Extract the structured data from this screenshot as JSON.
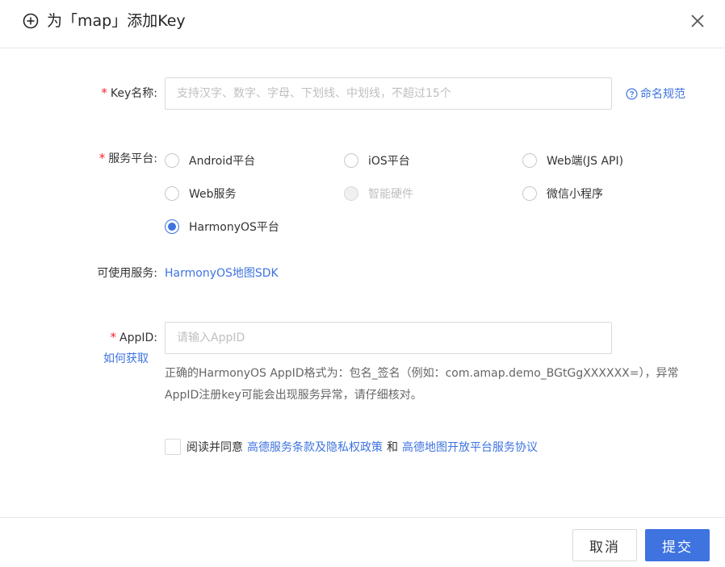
{
  "dialog": {
    "title": "为「map」添加Key"
  },
  "form": {
    "key_name": {
      "label": "Key名称:",
      "placeholder": "支持汉字、数字、字母、下划线、中划线，不超过15个",
      "value": "",
      "help_link": "命名规范"
    },
    "platform": {
      "label": "服务平台:",
      "options": [
        {
          "label": "Android平台",
          "checked": false,
          "disabled": false
        },
        {
          "label": "iOS平台",
          "checked": false,
          "disabled": false
        },
        {
          "label": "Web端(JS API)",
          "checked": false,
          "disabled": false
        },
        {
          "label": "Web服务",
          "checked": false,
          "disabled": false
        },
        {
          "label": "智能硬件",
          "checked": false,
          "disabled": true
        },
        {
          "label": "微信小程序",
          "checked": false,
          "disabled": false
        },
        {
          "label": "HarmonyOS平台",
          "checked": true,
          "disabled": false
        }
      ]
    },
    "available_services": {
      "label": "可使用服务:",
      "value": "HarmonyOS地图SDK"
    },
    "appid": {
      "label": "AppID:",
      "placeholder": "请输入AppID",
      "value": "",
      "how_link": "如何获取",
      "hint": "正确的HarmonyOS AppID格式为：包名_签名（例如：com.amap.demo_BGtGgXXXXXX=），异常AppID注册key可能会出现服务异常，请仔细核对。"
    },
    "agreement": {
      "prefix": "阅读并同意",
      "link1": "高德服务条款及隐私权政策",
      "middle": "和",
      "link2": "高德地图开放平台服务协议",
      "checked": false
    }
  },
  "footer": {
    "cancel_label": "取消",
    "submit_label": "提交"
  },
  "colors": {
    "accent": "#3e73e0",
    "required": "#f5222d"
  }
}
